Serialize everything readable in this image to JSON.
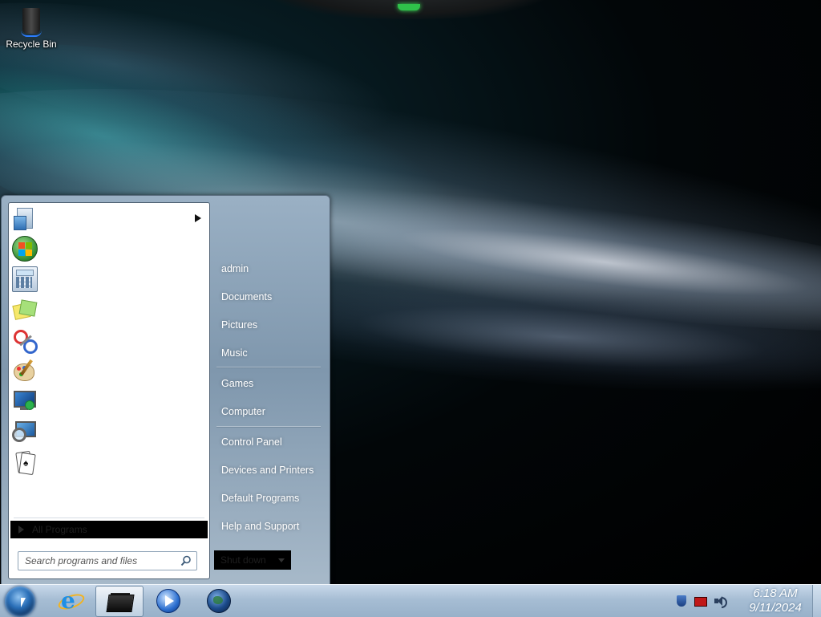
{
  "desktop": {
    "icons": [
      {
        "label": "Recycle Bin",
        "icon": "recycle-bin-icon"
      }
    ]
  },
  "start_menu": {
    "pinned_programs": [
      {
        "icon": "getting-started-icon",
        "has_submenu": true
      },
      {
        "icon": "windows-logo-icon",
        "has_submenu": false
      },
      {
        "icon": "calculator-icon",
        "has_submenu": false
      },
      {
        "icon": "sticky-notes-icon",
        "has_submenu": false
      },
      {
        "icon": "snipping-tool-icon",
        "has_submenu": false
      },
      {
        "icon": "paint-icon",
        "has_submenu": false
      },
      {
        "icon": "remote-desktop-icon",
        "has_submenu": false
      },
      {
        "icon": "magnifier-icon",
        "has_submenu": false
      },
      {
        "icon": "solitaire-icon",
        "has_submenu": false
      }
    ],
    "all_programs_label": "All Programs",
    "search": {
      "placeholder": "Search programs and files",
      "value": ""
    },
    "right_pane": {
      "items": [
        {
          "label": "admin"
        },
        {
          "label": "Documents"
        },
        {
          "label": "Pictures"
        },
        {
          "label": "Music"
        },
        {
          "label": "Games"
        },
        {
          "label": "Computer"
        },
        {
          "label": "Control Panel"
        },
        {
          "label": "Devices and Printers"
        },
        {
          "label": "Default Programs"
        },
        {
          "label": "Help and Support"
        }
      ],
      "shutdown_label": "Shut down"
    }
  },
  "taskbar": {
    "start_icon": "start-orb-icon",
    "pinned": [
      {
        "icon": "internet-explorer-icon",
        "active": false
      },
      {
        "icon": "file-explorer-icon",
        "active": true
      },
      {
        "icon": "media-player-icon",
        "active": false
      },
      {
        "icon": "globe-icon",
        "active": false
      }
    ],
    "tray": {
      "icons": [
        "shield-icon",
        "flag-icon",
        "speaker-icon"
      ],
      "time": "6:18 AM",
      "date": "9/11/2024"
    }
  }
}
